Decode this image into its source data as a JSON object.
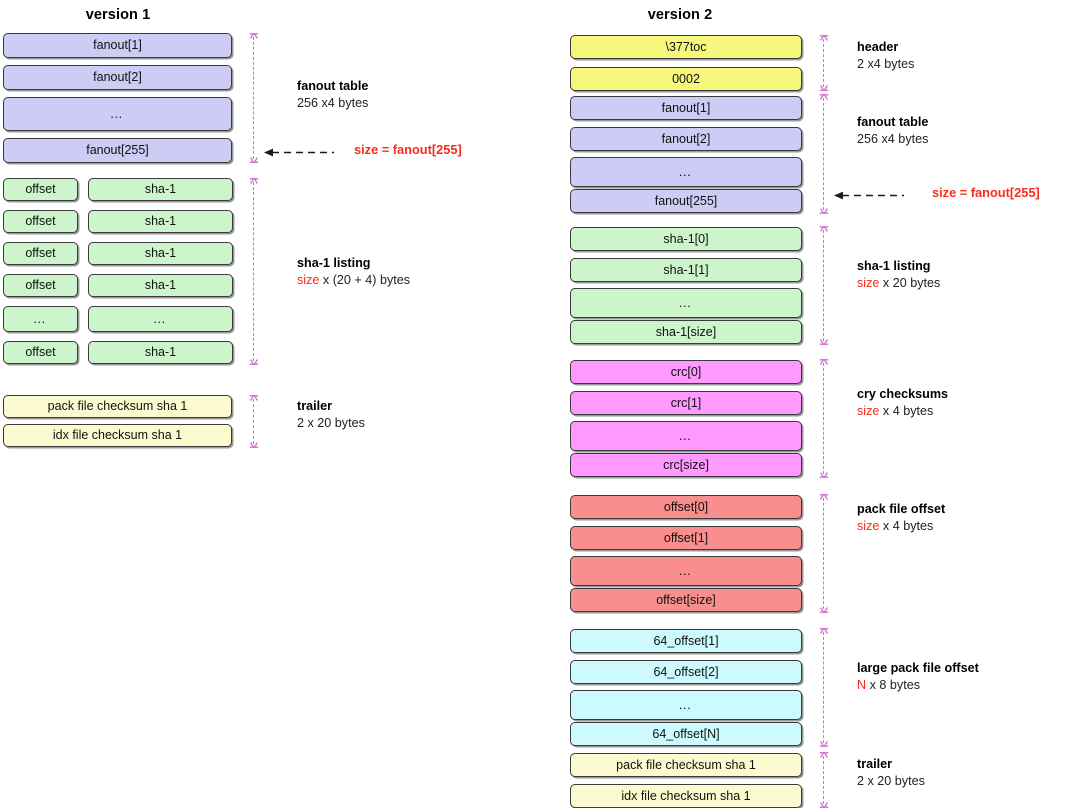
{
  "diagram": {
    "title_v1": "version 1",
    "title_v2": "version 2",
    "colors": {
      "fanout": "#ccccf5",
      "sha1": "#ccf5cc",
      "crc": "#ff99ff",
      "offset": "#f98e8e",
      "large_offset": "#ccfaff",
      "header": "#f7f77e",
      "trailer": "#fbfbcf",
      "bracket": "#d06fd0",
      "accent_red": "#fb2b1b",
      "border": "#3a3a3a"
    }
  },
  "version1": {
    "title": "version 1",
    "sections": [
      {
        "name": "fanout-table",
        "rows": [
          "fanout[1]",
          "fanout[2]",
          "…",
          "fanout[255]"
        ],
        "annotation": {
          "title": "fanout table",
          "sub_plain": "256 x4 bytes"
        },
        "callout": {
          "text": "size = fanout[255]"
        }
      },
      {
        "name": "sha-1-listing",
        "left_rows": [
          "offset",
          "offset",
          "offset",
          "offset",
          "…",
          "offset"
        ],
        "right_rows": [
          "sha-1",
          "sha-1",
          "sha-1",
          "sha-1",
          "…",
          "sha-1"
        ],
        "annotation": {
          "title": "sha-1 listing",
          "sub_red": "size",
          "sub_plain": " x (20 + 4) bytes"
        }
      },
      {
        "name": "trailer",
        "rows": [
          "pack file checksum sha 1",
          "idx file checksum sha 1"
        ],
        "annotation": {
          "title": "trailer",
          "sub_plain": "2 x 20 bytes"
        }
      }
    ]
  },
  "version2": {
    "title": "version 2",
    "sections": [
      {
        "name": "header",
        "rows": [
          "\\377toc",
          "0002"
        ],
        "annotation": {
          "title": "header",
          "sub_plain": "2 x4 bytes"
        }
      },
      {
        "name": "fanout-table",
        "rows": [
          "fanout[1]",
          "fanout[2]",
          "…",
          "fanout[255]"
        ],
        "annotation": {
          "title": "fanout table",
          "sub_plain": "256 x4 bytes"
        },
        "callout": {
          "text": "size = fanout[255]"
        }
      },
      {
        "name": "sha-1-listing",
        "rows": [
          "sha-1[0]",
          "sha-1[1]",
          "…",
          "sha-1[size]"
        ],
        "annotation": {
          "title": "sha-1 listing",
          "sub_red": "size",
          "sub_plain": " x 20 bytes"
        }
      },
      {
        "name": "crc-checksums",
        "rows": [
          "crc[0]",
          "crc[1]",
          "…",
          "crc[size]"
        ],
        "annotation": {
          "title": "cry checksums",
          "sub_red": "size",
          "sub_plain": " x 4 bytes"
        }
      },
      {
        "name": "pack-file-offset",
        "rows": [
          "offset[0]",
          "offset[1]",
          "…",
          "offset[size]"
        ],
        "annotation": {
          "title": "pack file offset",
          "sub_red": "size",
          "sub_plain": " x 4 bytes"
        }
      },
      {
        "name": "large-pack-file-offset",
        "rows": [
          "64_offset[1]",
          "64_offset[2]",
          "…",
          "64_offset[N]"
        ],
        "annotation": {
          "title": "large pack file offset",
          "sub_red": "N",
          "sub_plain": " x 8 bytes"
        }
      },
      {
        "name": "trailer",
        "rows": [
          "pack file checksum sha 1",
          "idx file checksum sha 1"
        ],
        "annotation": {
          "title": "trailer",
          "sub_plain": "2 x 20 bytes"
        }
      }
    ]
  }
}
